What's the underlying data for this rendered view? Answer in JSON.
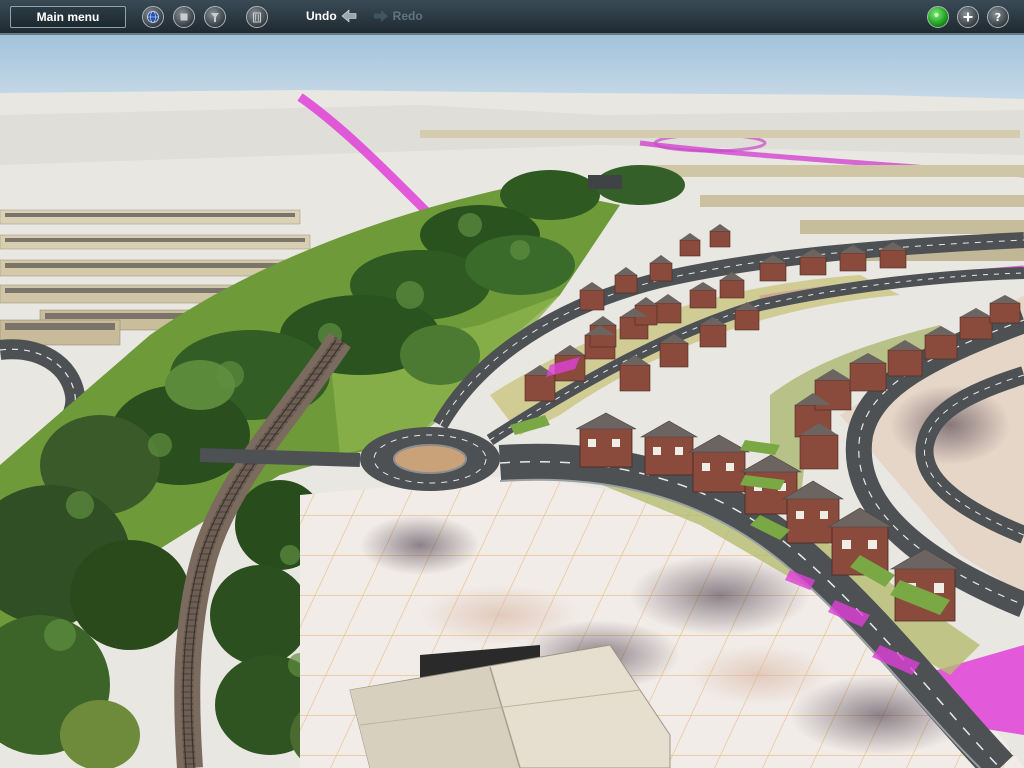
{
  "toolbar": {
    "main_menu_label": "Main menu",
    "undo_label": "Undo",
    "redo_label": "Redo",
    "left_icons": [
      "globe-icon",
      "stop-icon",
      "options-icon",
      "trash-icon"
    ],
    "right_icons": [
      "status-light-icon",
      "add-icon",
      "help-icon"
    ]
  },
  "colors": {
    "sky": "#a9c6dd",
    "road": "#4d5154",
    "road_markings": "#e8e8e8",
    "grass": "#6e9a3a",
    "trees": "#2f5a22",
    "house_brick": "#8a4a3c",
    "house_roof": "#6b6460",
    "terrain_highlight": "#e040d8",
    "grid_lines": "#e0a040"
  }
}
